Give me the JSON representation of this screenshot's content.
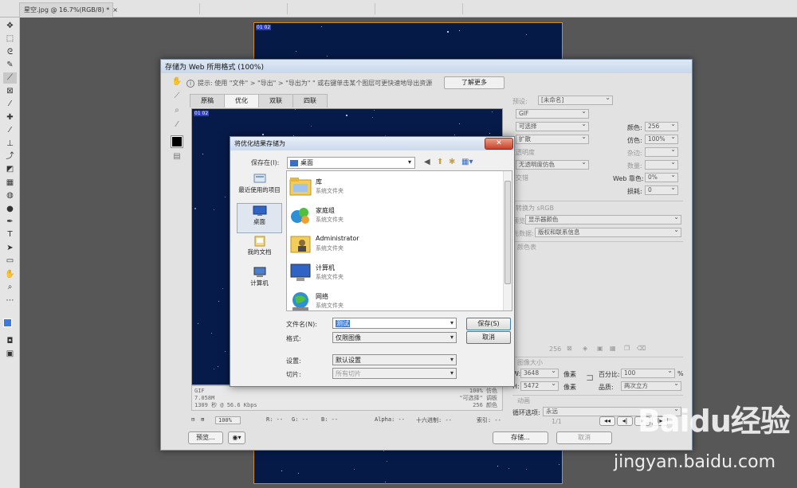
{
  "photoshop": {
    "doc_tab": "星空.jpg @ 16.7%(RGB/8) *",
    "doc_tab_close": "×",
    "canvas_label": "01 02"
  },
  "save_for_web": {
    "title": "存储为 Web 所用格式 (100%)",
    "hint_prefix": "提示:",
    "hint": "使用 \"文件\" > \"导出\" > \"导出为\"   \" 或右键单击某个图层可更快速地导出资源",
    "learn_more": "了解更多",
    "tabs": [
      "原稿",
      "优化",
      "双联",
      "四联"
    ],
    "preview_label": "01 02",
    "info_left": [
      "GIF",
      "7.058M",
      "1309 秒 @ 56.6 Kbps"
    ],
    "info_right": [
      "100% 仿色",
      "\"可选择\" 调板",
      "256 颜色"
    ],
    "status": {
      "zoom": "100%",
      "r": "R: --",
      "g": "G: --",
      "b": "B: --",
      "alpha": "Alpha: --",
      "hex": "十六进制: --",
      "index": "索引: --"
    },
    "preview_btn": "预览...",
    "save_btn": "存储...",
    "cancel_btn": "取消",
    "settings": {
      "preset_label": "预设:",
      "preset_value": "[未命名]",
      "format": "GIF",
      "reduction": "可选择",
      "dither_algo": "扩散",
      "transparency": "透明度",
      "matte_dither": "无透明度仿色",
      "interlace": "交错",
      "colors_label": "颜色:",
      "colors_value": "256",
      "dither_label": "仿色:",
      "dither_value": "100%",
      "matte_label": "杂边:",
      "amount_label": "数量:",
      "web_snap_label": "Web 靠色:",
      "web_snap_value": "0%",
      "lossy_label": "损耗:",
      "lossy_value": "0",
      "srgb": "转换为 sRGB",
      "preview_label": "预览:",
      "preview_value": "显示器颜色",
      "metadata_label": "元数据:",
      "metadata_value": "版权和联系信息",
      "color_table": "颜色表",
      "color_count": "256",
      "image_size": "图像大小",
      "w_label": "W:",
      "w_value": "3648",
      "h_label": "H:",
      "h_value": "5472",
      "px": "像素",
      "percent_label": "百分比:",
      "percent_value": "100",
      "percent_unit": "%",
      "quality_label": "品质:",
      "quality_value": "两次立方",
      "animation": "动画",
      "loop_label": "循环选项:",
      "loop_value": "永远",
      "frame": "1/1"
    }
  },
  "save_dialog": {
    "title": "将优化结果存储为",
    "close": "✕",
    "save_in_label": "保存在(I):",
    "save_in_value": "桌面",
    "places": [
      "最近使用的项目",
      "桌面",
      "我的文档",
      "计算机"
    ],
    "items": [
      {
        "name": "库",
        "sub": "系统文件夹"
      },
      {
        "name": "家庭组",
        "sub": "系统文件夹"
      },
      {
        "name": "Administrator",
        "sub": "系统文件夹"
      },
      {
        "name": "计算机",
        "sub": "系统文件夹"
      },
      {
        "name": "网络",
        "sub": "系统文件夹"
      }
    ],
    "filename_label": "文件名(N):",
    "filename_value": "测试",
    "format_label": "格式:",
    "format_value": "仅限图像",
    "settings_label": "设置:",
    "settings_value": "默认设置",
    "slices_label": "切片:",
    "slices_value": "所有切片",
    "save_btn": "保存(S)",
    "cancel_btn": "取消"
  },
  "watermark": {
    "logo": "Baidu经验",
    "url": "jingyan.baidu.com"
  },
  "colors": {
    "accent": "#3c7fb1",
    "sky": "#061a48",
    "dialog_bg": "#e2e2e2"
  }
}
